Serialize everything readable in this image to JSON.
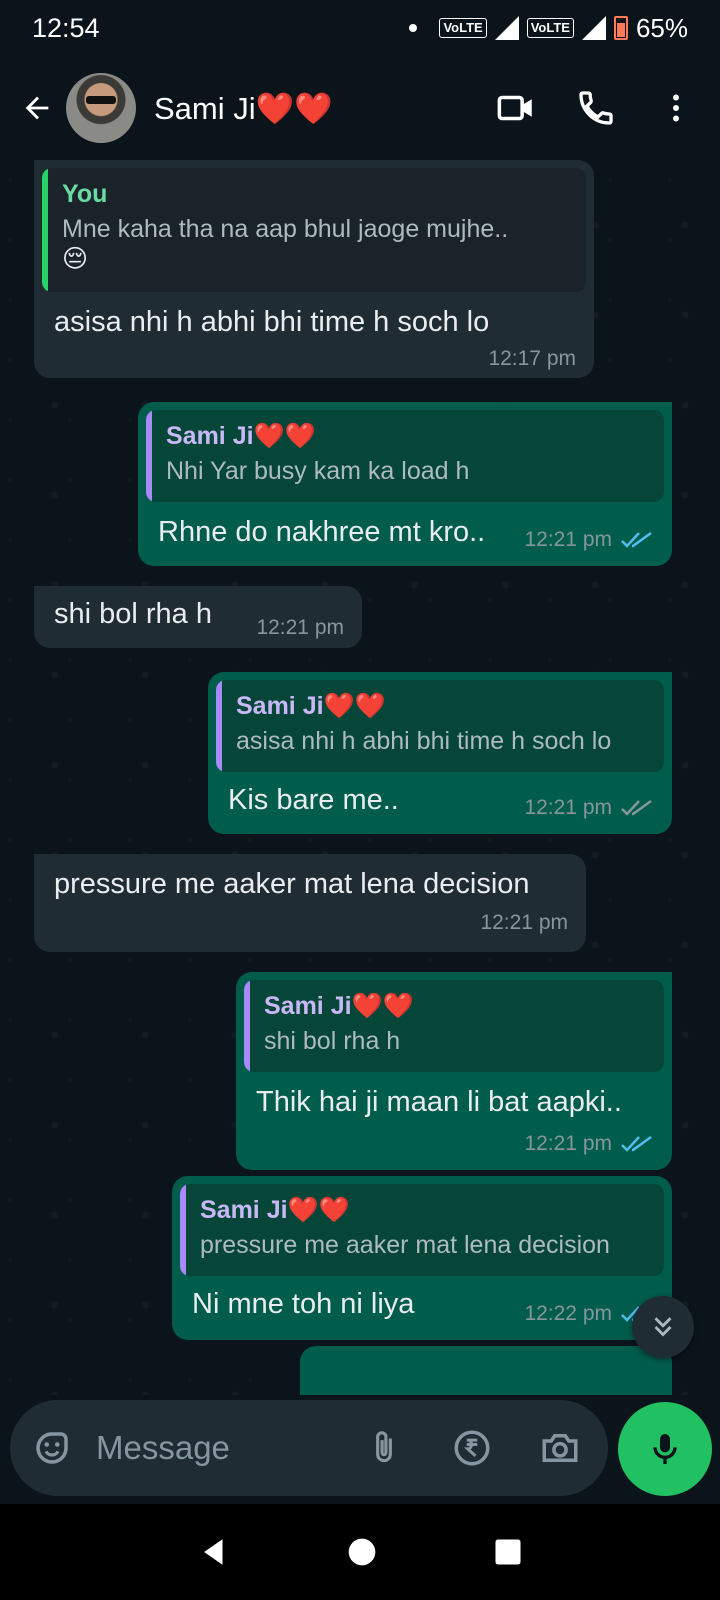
{
  "status_bar": {
    "time": "12:54",
    "volte1": "VoLTE",
    "volte2": "VoLTE",
    "battery": "65%"
  },
  "header": {
    "contact_name": "Sami Ji",
    "hearts": "❤️❤️"
  },
  "messages": [
    {
      "direction": "in",
      "quote_name": "You",
      "quote_text": "Mne kaha tha na aap bhul jaoge mujhe..",
      "quote_emoji": "😔",
      "text": "asisa nhi h abhi bhi time h soch lo",
      "time": "12:17 pm"
    },
    {
      "direction": "out",
      "quote_name": "Sami Ji",
      "quote_text": "Nhi Yar busy kam ka load h",
      "text": "Rhne do nakhree mt kro..",
      "time": "12:21 pm",
      "status": "read"
    },
    {
      "direction": "in",
      "text": "shi bol rha h",
      "time": "12:21 pm"
    },
    {
      "direction": "out",
      "quote_name": "Sami Ji",
      "quote_text": "asisa nhi h abhi bhi time h soch lo",
      "text": "Kis bare me..",
      "time": "12:21 pm",
      "status": "delivered"
    },
    {
      "direction": "in",
      "text": "pressure me aaker mat lena decision",
      "time": "12:21 pm"
    },
    {
      "direction": "out",
      "quote_name": "Sami Ji",
      "quote_text": "shi bol rha h",
      "text": "Thik hai ji maan li bat aapki..",
      "time": "12:21 pm",
      "status": "read"
    },
    {
      "direction": "out",
      "quote_name": "Sami Ji",
      "quote_text": "pressure me aaker mat lena decision",
      "text": "Ni mne toh ni liya",
      "time": "12:22 pm",
      "status": "read"
    }
  ],
  "composer": {
    "placeholder": "Message"
  },
  "icons": {
    "back": "arrow-left-icon",
    "video": "video-call-icon",
    "call": "phone-icon",
    "menu": "more-vertical-icon",
    "sticker": "sticker-icon",
    "attach": "paperclip-icon",
    "payment": "rupee-icon",
    "camera": "camera-icon",
    "mic": "mic-icon",
    "scroll": "double-chevron-down-icon"
  },
  "colors": {
    "background": "#0b141a",
    "incoming_bubble": "#202c33",
    "outgoing_bubble": "#005c4b",
    "accent_green": "#21c063",
    "read_tick": "#53bdeb"
  }
}
